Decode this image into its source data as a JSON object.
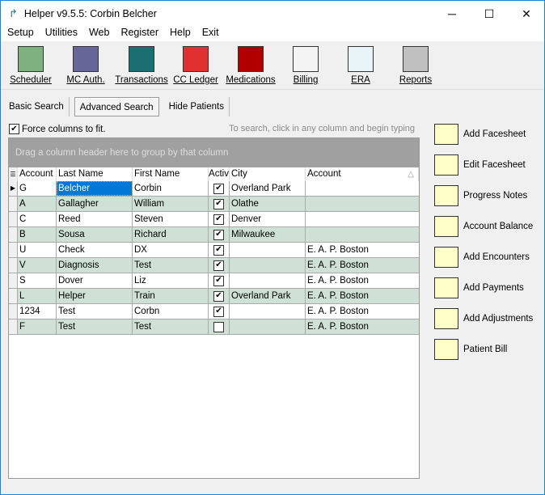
{
  "window": {
    "title": "Helper v9.5.5: Corbin Belcher",
    "minimize": "─",
    "maximize": "☐",
    "close": "✕"
  },
  "menu": [
    "Setup",
    "Utilities",
    "Web",
    "Register",
    "Help",
    "Exit"
  ],
  "toolbar": [
    {
      "label": "Scheduler",
      "color": "#7fb07f"
    },
    {
      "label": "MC Auth.",
      "color": "#666699"
    },
    {
      "label": "Transactions",
      "color": "#1a7070"
    },
    {
      "label": "CC Ledger",
      "color": "#e03030"
    },
    {
      "label": "Medications",
      "color": "#b00000"
    },
    {
      "label": "Billing",
      "color": "#f4f4f4"
    },
    {
      "label": "ERA",
      "color": "#e8f4f8"
    },
    {
      "label": "Reports",
      "color": "#c0c0c0"
    }
  ],
  "tabs": [
    "Basic Search",
    "Advanced Search",
    "Hide Patients"
  ],
  "force_columns": {
    "label": "Force columns to fit.",
    "checked": true
  },
  "search_hint": "To search, click in any column and begin typing",
  "grid": {
    "group_hint": "Drag a column header here to group by that column",
    "columns": [
      "Account :",
      "Last Name",
      "First Name",
      "Activ",
      "City",
      "Account"
    ],
    "sort_icon": "△",
    "rows": [
      [
        "G",
        "Belcher",
        "Corbin",
        true,
        "Overland Park",
        ""
      ],
      [
        "A",
        "Gallagher",
        "William",
        true,
        "Olathe",
        ""
      ],
      [
        "C",
        "Reed",
        "Steven",
        true,
        "Denver",
        ""
      ],
      [
        "B",
        "Sousa",
        "Richard",
        true,
        "Milwaukee",
        ""
      ],
      [
        "U",
        "Check",
        "DX",
        true,
        "",
        "E. A. P. Boston"
      ],
      [
        "V",
        "Diagnosis",
        "Test",
        true,
        "",
        "E. A. P. Boston"
      ],
      [
        "S",
        "Dover",
        "Liz",
        true,
        "",
        "E. A. P. Boston"
      ],
      [
        "L",
        "Helper",
        "Train",
        true,
        "Overland Park",
        "E. A. P. Boston"
      ],
      [
        "1234",
        "Test",
        "Corbn",
        true,
        "",
        "E. A. P. Boston"
      ],
      [
        "F",
        "Test",
        "Test",
        false,
        "",
        "E. A. P. Boston"
      ]
    ]
  },
  "side_buttons": [
    "Add Facesheet",
    "Edit Facesheet",
    "Progress Notes",
    "Account Balance",
    "Add Encounters",
    "Add Payments",
    "Add Adjustments",
    "Patient Bill"
  ]
}
